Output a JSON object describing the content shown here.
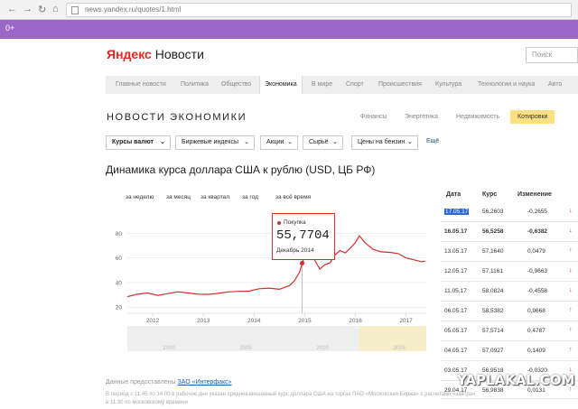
{
  "browser": {
    "url": "news.yandex.ru/quotes/1.html"
  },
  "bookmarks": {
    "text": "0+"
  },
  "header": {
    "logo_brand": "Яндекс",
    "logo_rest": "Новости",
    "search_placeholder": "Поиск"
  },
  "nav": {
    "items": [
      "Главные новости",
      "Политика",
      "Общество",
      "Экономика",
      "В мире",
      "Спорт",
      "Происшествия",
      "Культура",
      "Технологии и наука",
      "Авто"
    ],
    "active": "Экономика"
  },
  "section": {
    "title": "НОВОСТИ ЭКОНОМИКИ",
    "subnav": [
      "Финансы",
      "Энергетика",
      "Недвижимость",
      "Котировки"
    ]
  },
  "filters": [
    "Курсы валют",
    "Биржевые индексы",
    "Акции",
    "Сырьё",
    "Цены на бензин"
  ],
  "more_link": "Ещё",
  "chart_title": "Динамика курса доллара США к рублю (USD, ЦБ РФ)",
  "periods": [
    "за неделю",
    "за месяц",
    "за квартал",
    "за год",
    "за всё время"
  ],
  "tooltip": {
    "label": "Покупка",
    "value": "55,7704",
    "date": "Декабрь 2014"
  },
  "table": {
    "headers": [
      "Дата",
      "Курс",
      "Изменение"
    ],
    "rows": [
      {
        "date": "17.05.17",
        "rate": "56,2603",
        "change": "-0,2655",
        "dir": "down"
      },
      {
        "date": "16.05.17",
        "rate": "56,5258",
        "change": "-0,6382",
        "dir": "down"
      },
      {
        "date": "13.05.17",
        "rate": "57,1640",
        "change": "0,0479",
        "dir": "up"
      },
      {
        "date": "12.05.17",
        "rate": "57,1161",
        "change": "-0,9663",
        "dir": "down"
      },
      {
        "date": "11.05.17",
        "rate": "58,0824",
        "change": "-0,4558",
        "dir": "down"
      },
      {
        "date": "06.05.17",
        "rate": "58,5382",
        "change": "0,9668",
        "dir": "up"
      },
      {
        "date": "05.05.17",
        "rate": "57,5714",
        "change": "0,4787",
        "dir": "up"
      },
      {
        "date": "04.05.17",
        "rate": "57,0927",
        "change": "0,1409",
        "dir": "up"
      },
      {
        "date": "03.05.17",
        "rate": "56,9518",
        "change": "-0,0320",
        "dir": "down"
      },
      {
        "date": "29.04.17",
        "rate": "56,9838",
        "change": "0,0131",
        "dir": "up"
      }
    ]
  },
  "source": {
    "prefix": "Данные предоставлены",
    "link": "ЗАО «Интерфакс»",
    "note": "В период с 11.45 по 14.00 в рабочие дни указан средневзвешенный курс доллара США на торгах ПАО «Московская Биржа» с расчетами «завтра» в 11.30 по московскому времени"
  },
  "watermark": "YAPLAKAL.COM",
  "colors": {
    "accent": "#d32f2f",
    "nav_purple": "#9a66c8",
    "subnav_active": "#fce084"
  },
  "chart_data": {
    "type": "line",
    "title": "Динамика курса доллара США к рублю (USD, ЦБ РФ)",
    "x_ticks": [
      "2012",
      "2013",
      "2014",
      "2015",
      "2016",
      "2017"
    ],
    "y_ticks": [
      20,
      40,
      60,
      80
    ],
    "ylim": [
      15,
      95
    ],
    "xlim": [
      2011.5,
      2017.4
    ],
    "series": [
      {
        "values": [
          [
            2011.5,
            28.5
          ],
          [
            2011.7,
            30.5
          ],
          [
            2011.9,
            31.5
          ],
          [
            2012.1,
            29.5
          ],
          [
            2012.3,
            31.0
          ],
          [
            2012.5,
            32.5
          ],
          [
            2012.7,
            31.5
          ],
          [
            2012.9,
            30.5
          ],
          [
            2013.1,
            30.4
          ],
          [
            2013.3,
            31.2
          ],
          [
            2013.5,
            32.5
          ],
          [
            2013.7,
            32.8
          ],
          [
            2013.9,
            33.0
          ],
          [
            2014.1,
            35.0
          ],
          [
            2014.3,
            35.5
          ],
          [
            2014.5,
            34.5
          ],
          [
            2014.7,
            37.5
          ],
          [
            2014.8,
            41.5
          ],
          [
            2014.9,
            48.5
          ],
          [
            2014.95,
            55.77
          ],
          [
            2015.0,
            62.0
          ],
          [
            2015.1,
            68.0
          ],
          [
            2015.2,
            58.0
          ],
          [
            2015.3,
            51.0
          ],
          [
            2015.4,
            54.5
          ],
          [
            2015.5,
            56.0
          ],
          [
            2015.6,
            62.5
          ],
          [
            2015.7,
            66.0
          ],
          [
            2015.8,
            64.0
          ],
          [
            2015.9,
            68.0
          ],
          [
            2016.0,
            72.5
          ],
          [
            2016.08,
            78.0
          ],
          [
            2016.2,
            72.0
          ],
          [
            2016.35,
            67.0
          ],
          [
            2016.5,
            65.0
          ],
          [
            2016.7,
            64.5
          ],
          [
            2016.85,
            63.5
          ],
          [
            2017.0,
            60.0
          ],
          [
            2017.15,
            58.5
          ],
          [
            2017.3,
            57.0
          ],
          [
            2017.38,
            57.3
          ]
        ]
      }
    ],
    "highlight": {
      "x": 2014.95,
      "y": 55.77
    }
  }
}
